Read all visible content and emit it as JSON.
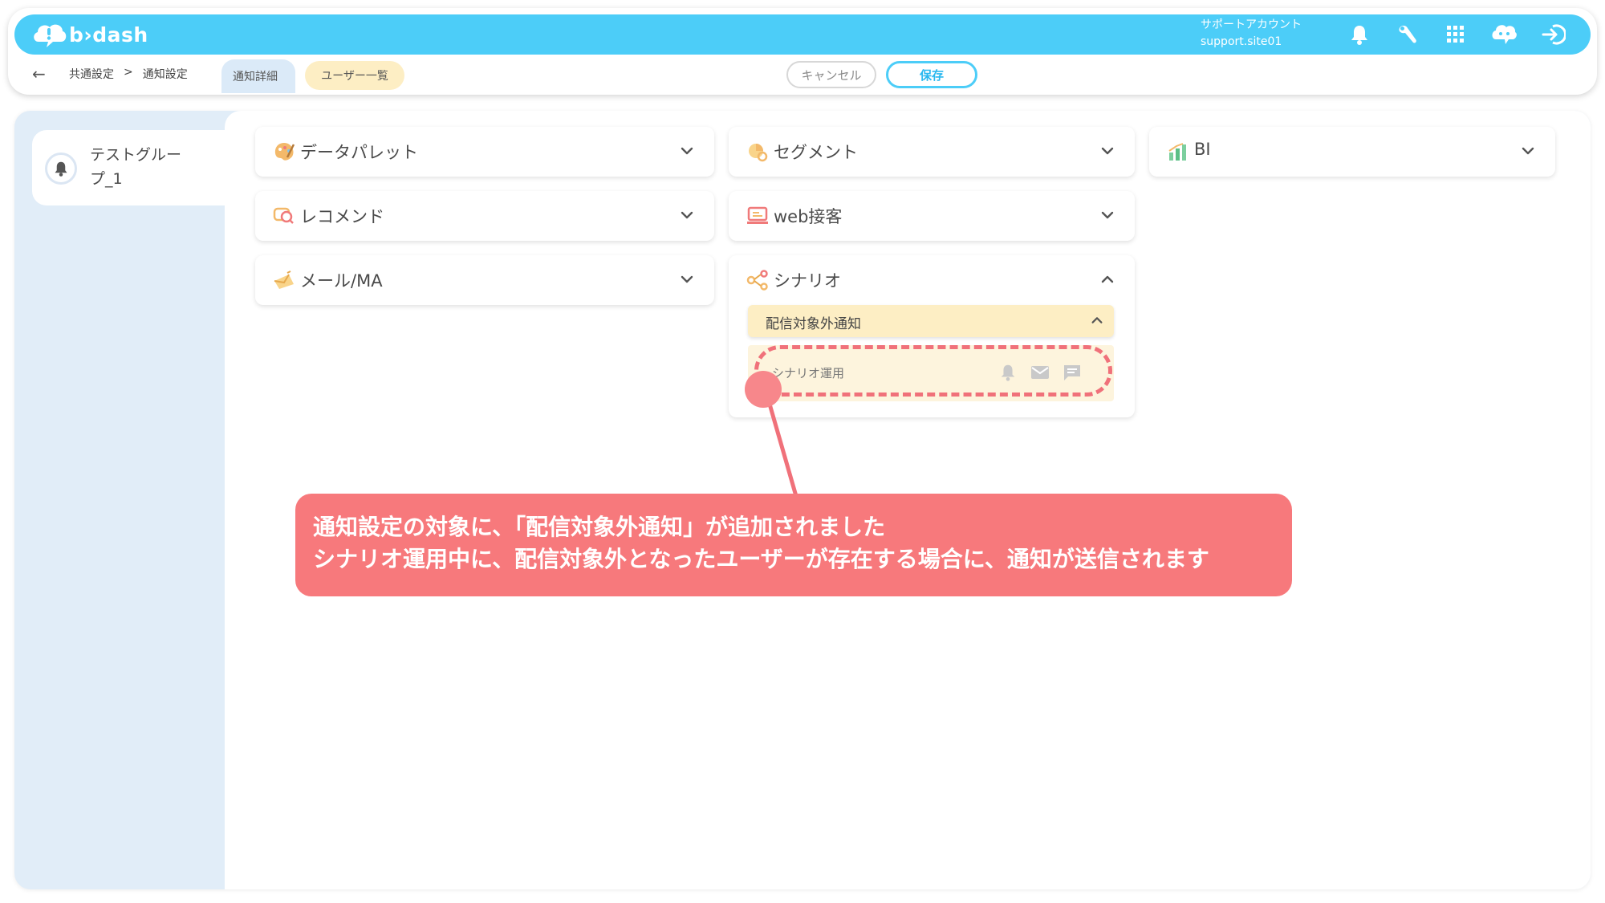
{
  "header": {
    "logo_text": "b›dash",
    "account_name": "サポートアカウント",
    "account_id": "support.site01",
    "icons": [
      "bell-icon",
      "wrench-icon",
      "grid-icon",
      "chat-bot-icon",
      "logout-icon"
    ]
  },
  "subbar": {
    "back_label": "←",
    "breadcrumb": [
      "共通設定",
      ">",
      "通知設定"
    ],
    "tabs": [
      {
        "label": "通知詳細"
      },
      {
        "label": "ユーザー一覧"
      }
    ],
    "cancel_label": "キャンセル",
    "save_label": "保存"
  },
  "sidebar": {
    "group_name": "テストグループ_1"
  },
  "panels": {
    "data_palette": "データパレット",
    "segment": "セグメント",
    "bi": "BI",
    "recommend": "レコメンド",
    "web_service": "web接客",
    "mail_ma": "メール/MA",
    "scenario": {
      "title": "シナリオ",
      "subsection_title": "配信対象外通知",
      "row_label": "シナリオ運用"
    }
  },
  "annotation": {
    "line1": "通知設定の対象に、「配信対象外通知」が追加されました",
    "line2": "シナリオ運用中に、配信対象外となったユーザーが存在する場合に、通知が送信されます"
  },
  "colors": {
    "brand": "#4ccdf8",
    "tab_detail": "#dbeaf8",
    "tab_users": "#fdeec4",
    "callout": "#f7797c"
  }
}
